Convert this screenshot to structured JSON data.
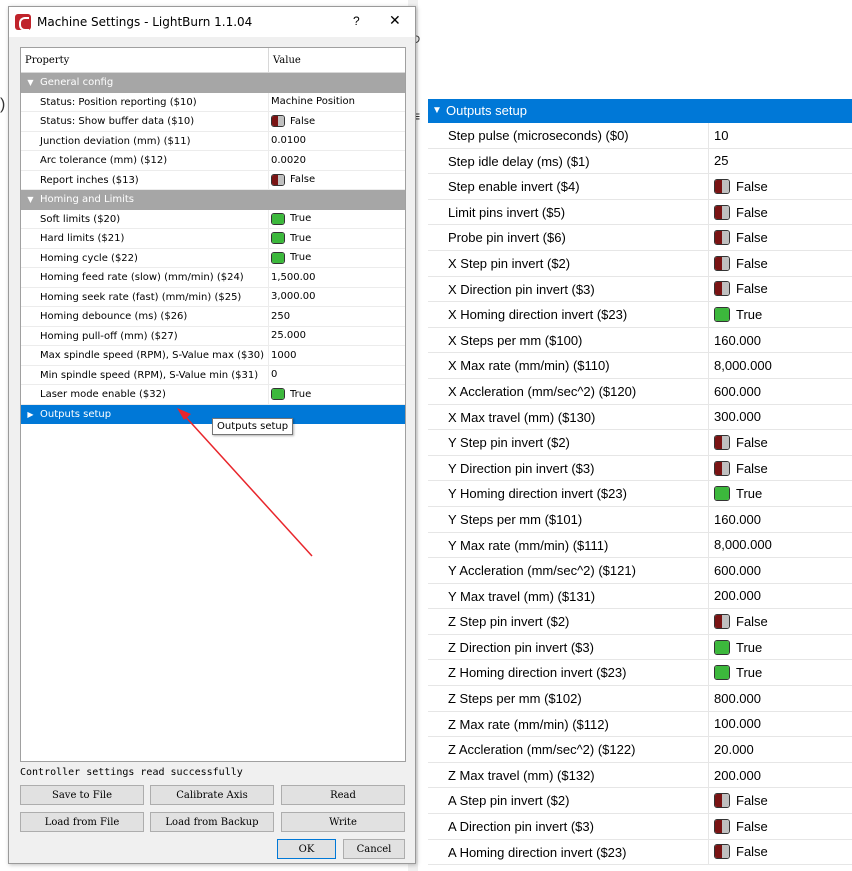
{
  "dialog": {
    "title": "Machine Settings - LightBurn 1.1.04",
    "help_label": "?",
    "close_label": "✕",
    "columns": {
      "property": "Property",
      "value": "Value"
    },
    "categories": [
      {
        "name": "General config",
        "rows": [
          {
            "property": "Status: Position reporting ($10)",
            "value": "Machine Position"
          },
          {
            "property": "Status: Show buffer data ($10)",
            "value": "False",
            "toggle": "off"
          },
          {
            "property": "Junction deviation (mm) ($11)",
            "value": "0.0100"
          },
          {
            "property": "Arc tolerance (mm) ($12)",
            "value": "0.0020"
          },
          {
            "property": "Report inches ($13)",
            "value": "False",
            "toggle": "off"
          }
        ]
      },
      {
        "name": "Homing and Limits",
        "rows": [
          {
            "property": "Soft limits ($20)",
            "value": "True",
            "toggle": "on"
          },
          {
            "property": "Hard limits ($21)",
            "value": "True",
            "toggle": "on"
          },
          {
            "property": "Homing cycle ($22)",
            "value": "True",
            "toggle": "on"
          },
          {
            "property": "Homing feed rate (slow) (mm/min) ($24)",
            "value": "1,500.00"
          },
          {
            "property": "Homing seek rate (fast) (mm/min) ($25)",
            "value": "3,000.00"
          },
          {
            "property": "Homing debounce (ms) ($26)",
            "value": "250"
          },
          {
            "property": "Homing pull-off (mm) ($27)",
            "value": "25.000"
          },
          {
            "property": "Max spindle speed (RPM), S-Value max ($30)",
            "value": "1000"
          },
          {
            "property": "Min spindle speed (RPM), S-Value min ($31)",
            "value": "0"
          },
          {
            "property": "Laser mode enable ($32)",
            "value": "True",
            "toggle": "on"
          }
        ]
      }
    ],
    "selected_category": "Outputs setup",
    "tooltip": "Outputs setup",
    "status": "Controller settings read successfully",
    "buttons": {
      "save_to_file": "Save to File",
      "calibrate_axis": "Calibrate Axis",
      "read": "Read",
      "load_from_file": "Load from File",
      "load_from_backup": "Load from Backup",
      "write": "Write",
      "ok": "OK",
      "cancel": "Cancel"
    }
  },
  "outputs_panel": {
    "title": "Outputs setup",
    "rows": [
      {
        "property": "Step pulse (microseconds) ($0)",
        "value": "10"
      },
      {
        "property": "Step idle delay (ms) ($1)",
        "value": "25"
      },
      {
        "property": "Step enable invert ($4)",
        "value": "False",
        "toggle": "off"
      },
      {
        "property": "Limit pins invert ($5)",
        "value": "False",
        "toggle": "off"
      },
      {
        "property": "Probe pin invert ($6)",
        "value": "False",
        "toggle": "off"
      },
      {
        "property": "X Step pin invert ($2)",
        "value": "False",
        "toggle": "off"
      },
      {
        "property": "X Direction pin invert ($3)",
        "value": "False",
        "toggle": "off"
      },
      {
        "property": "X Homing direction invert ($23)",
        "value": "True",
        "toggle": "on"
      },
      {
        "property": "X Steps per mm ($100)",
        "value": "160.000"
      },
      {
        "property": "X Max rate (mm/min) ($110)",
        "value": "8,000.000"
      },
      {
        "property": "X Accleration (mm/sec^2) ($120)",
        "value": "600.000"
      },
      {
        "property": "X Max travel (mm) ($130)",
        "value": "300.000"
      },
      {
        "property": "Y Step pin invert ($2)",
        "value": "False",
        "toggle": "off"
      },
      {
        "property": "Y Direction pin invert ($3)",
        "value": "False",
        "toggle": "off"
      },
      {
        "property": "Y Homing direction invert ($23)",
        "value": "True",
        "toggle": "on"
      },
      {
        "property": "Y Steps per mm ($101)",
        "value": "160.000"
      },
      {
        "property": "Y Max rate (mm/min) ($111)",
        "value": "8,000.000"
      },
      {
        "property": "Y Accleration (mm/sec^2) ($121)",
        "value": "600.000"
      },
      {
        "property": "Y Max travel (mm) ($131)",
        "value": "200.000"
      },
      {
        "property": "Z Step pin invert ($2)",
        "value": "False",
        "toggle": "off"
      },
      {
        "property": "Z Direction pin invert ($3)",
        "value": "True",
        "toggle": "on"
      },
      {
        "property": "Z Homing direction invert ($23)",
        "value": "True",
        "toggle": "on"
      },
      {
        "property": "Z Steps per mm ($102)",
        "value": "800.000"
      },
      {
        "property": "Z Max rate (mm/min) ($112)",
        "value": "100.000"
      },
      {
        "property": "Z Accleration (mm/sec^2) ($122)",
        "value": "20.000"
      },
      {
        "property": "Z Max travel (mm) ($132)",
        "value": "200.000"
      },
      {
        "property": "A Step pin invert ($2)",
        "value": "False",
        "toggle": "off"
      },
      {
        "property": "A Direction pin invert ($3)",
        "value": "False",
        "toggle": "off"
      },
      {
        "property": "A Homing direction invert ($23)",
        "value": "False",
        "toggle": "off"
      }
    ]
  },
  "colors": {
    "selection": "#0078d7",
    "category_header": "#a6a6a6",
    "toggle_on": "#3cb83c",
    "toggle_off": "#7a1414",
    "annotation_arrow": "#e8262c"
  }
}
